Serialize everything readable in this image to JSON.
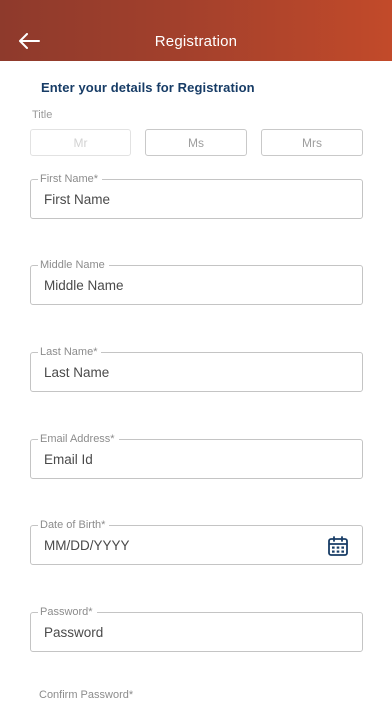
{
  "header": {
    "title": "Registration",
    "back_icon": "arrow-left-icon"
  },
  "form": {
    "heading": "Enter your details for Registration",
    "title_label": "Title",
    "title_options": [
      "Mr",
      "Ms",
      "Mrs"
    ],
    "fields": {
      "first_name": {
        "label": "First Name*",
        "placeholder": "First Name"
      },
      "middle_name": {
        "label": "Middle Name",
        "placeholder": "Middle Name"
      },
      "last_name": {
        "label": "Last Name*",
        "placeholder": "Last Name"
      },
      "email": {
        "label": "Email Address*",
        "placeholder": "Email Id"
      },
      "dob": {
        "label": "Date of Birth*",
        "placeholder": "MM/DD/YYYY",
        "icon": "calendar-icon"
      },
      "password": {
        "label": "Password*",
        "placeholder": "Password"
      },
      "confirm_password": {
        "label": "Confirm Password*"
      }
    }
  },
  "colors": {
    "header_start": "#8e3a2c",
    "header_end": "#c24a2a",
    "heading": "#173c66",
    "calendar_icon": "#173c66"
  }
}
